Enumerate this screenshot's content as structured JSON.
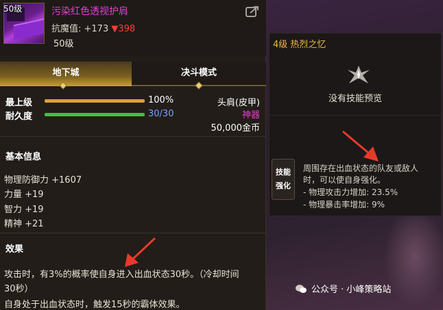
{
  "item": {
    "icon_level": "50级",
    "name": "污染红色透视护肩",
    "resist_label": "抗魔值: +173",
    "resist_down": "▼398",
    "level": "50级"
  },
  "tabs": [
    {
      "label": "地下城",
      "active": true
    },
    {
      "label": "决斗模式",
      "active": false
    }
  ],
  "stats": {
    "top_label": "最上级",
    "top_value": "100%",
    "top_fill": 1.0,
    "durability_label": "耐久度",
    "durability_value": "30/30",
    "durability_fill": 1.0
  },
  "meta": {
    "slot": "头肩(皮甲)",
    "rarity": "神器",
    "price": "50,000金币"
  },
  "basic_info": {
    "title": "基本信息",
    "lines": [
      "物理防御力 +1607",
      "力量 +19",
      "智力 +19",
      "精神 +21"
    ]
  },
  "effect": {
    "title": "效果",
    "line1": "攻击时，有3%的概率使自身进入出血状态30秒。（冷却时间",
    "line2": "30秒）",
    "line3": "自身处于出血状态时，触发15秒的霸体效果。"
  },
  "skill": {
    "title": "4级 热烈之忆",
    "no_preview": "没有技能预览",
    "enhance_label_1": "技能",
    "enhance_label_2": "强化",
    "desc_1": "周围存在出血状态的队友或敌人",
    "desc_2": "时，可以使自身强化。",
    "desc_3": "- 物理攻击力增加: 23.5%",
    "desc_4": "- 物理暴击率增加: 9%"
  },
  "watermark": "公众号 · 小峰策略站",
  "colors": {
    "item_name": "#e040d0",
    "resist_down": "#ff3b3b",
    "rarity": "#e040d0",
    "skill_title": "#f0b840",
    "top_bar": "#e0a030",
    "durability_bar": "#40c040",
    "durability_value": "#7aa0ff",
    "arrow": "#e83a2a"
  }
}
